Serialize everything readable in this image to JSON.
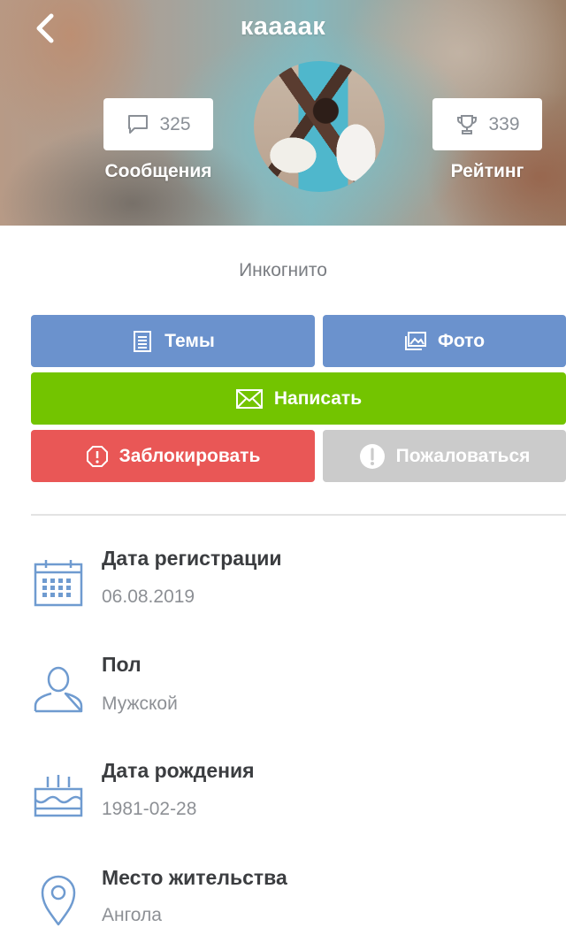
{
  "header": {
    "title": "кaaaaк",
    "messages": {
      "count": "325",
      "label": "Сообщения"
    },
    "rating": {
      "count": "339",
      "label": "Рейтинг"
    }
  },
  "status": "Инкогнито",
  "actions": {
    "topics": "Темы",
    "photo": "Фото",
    "write": "Написать",
    "block": "Заблокировать",
    "report": "Пожаловаться"
  },
  "info": [
    {
      "title": "Дата регистрации",
      "value": "06.08.2019"
    },
    {
      "title": "Пол",
      "value": "Мужской"
    },
    {
      "title": "Дата рождения",
      "value": "1981-02-28"
    },
    {
      "title": "Место жительства",
      "value": "Ангола"
    }
  ]
}
